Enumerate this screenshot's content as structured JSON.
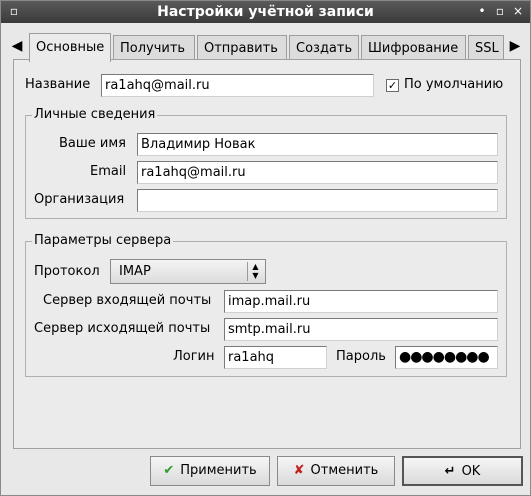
{
  "window": {
    "title": "Настройки учётной записи",
    "controls": [
      "•",
      "▫",
      "×"
    ]
  },
  "tabs": {
    "prev_arrow": "◀",
    "next_arrow": "▶",
    "items": [
      {
        "label": "Основные",
        "active": true
      },
      {
        "label": "Получить",
        "active": false
      },
      {
        "label": "Отправить",
        "active": false
      },
      {
        "label": "Создать",
        "active": false
      },
      {
        "label": "Шифрование",
        "active": false
      },
      {
        "label": "SSL",
        "active": false
      }
    ]
  },
  "account": {
    "name_label": "Название",
    "name_value": "ra1ahq@mail.ru",
    "default_checked": "✓",
    "default_label": "По умолчанию"
  },
  "personal": {
    "title": "Личные сведения",
    "your_name_label": "Ваше имя",
    "your_name_value": "Владимир Новак",
    "email_label": "Email",
    "email_value": "ra1ahq@mail.ru",
    "org_label": "Организация",
    "org_value": ""
  },
  "server": {
    "title": "Параметры сервера",
    "protocol_label": "Протокол",
    "protocol_value": "IMAP",
    "incoming_label": "Сервер входящей почты",
    "incoming_value": "imap.mail.ru",
    "outgoing_label": "Сервер исходящей почты",
    "outgoing_value": "smtp.mail.ru",
    "login_label": "Логин",
    "login_value": "ra1ahq",
    "password_label": "Пароль",
    "password_mask": "●●●●●●●●"
  },
  "buttons": {
    "apply": "Применить",
    "cancel": "Отменить",
    "ok": "OK",
    "apply_icon": "✔",
    "cancel_icon": "✘",
    "ok_icon": "↵"
  },
  "colors": {
    "titlebar": "#3a3a3a",
    "apply_icon": "#2e9a2e",
    "cancel_icon": "#c02020"
  }
}
